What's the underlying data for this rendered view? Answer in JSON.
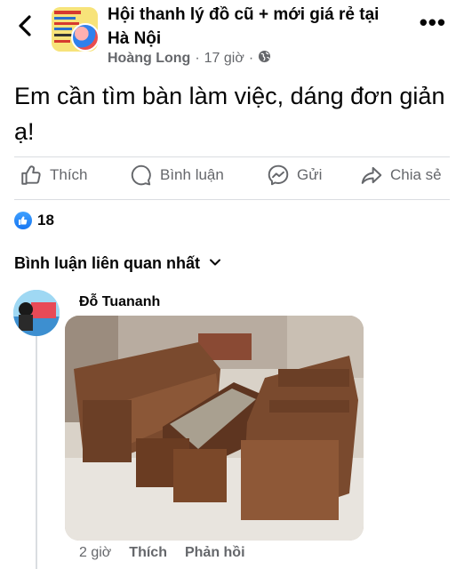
{
  "header": {
    "group_name": "Hội thanh lý đồ cũ + mới giá rẻ tại Hà Nội",
    "author": "Hoàng Long",
    "time": "17 giờ",
    "separator": "·",
    "more_label": "•••"
  },
  "post": {
    "text": "Em cần tìm bàn làm việc, dáng đơn giản ạ!"
  },
  "actions": {
    "like": "Thích",
    "comment": "Bình luận",
    "send": "Gửi",
    "share": "Chia sẻ"
  },
  "reactions": {
    "count": "18"
  },
  "comments": {
    "sort_label": "Bình luận liên quan nhất",
    "items": [
      {
        "author": "Đỗ Tuananh",
        "time": "2 giờ",
        "like": "Thích",
        "reply": "Phản hồi"
      }
    ]
  },
  "colors": {
    "accent": "#1877f2",
    "secondary_text": "#65676b",
    "divider": "#dadde1"
  },
  "icons": [
    "back-arrow-icon",
    "globe-icon",
    "more-icon",
    "thumbs-up-icon",
    "comment-bubble-icon",
    "messenger-icon",
    "share-arrow-icon",
    "chevron-down-icon"
  ]
}
